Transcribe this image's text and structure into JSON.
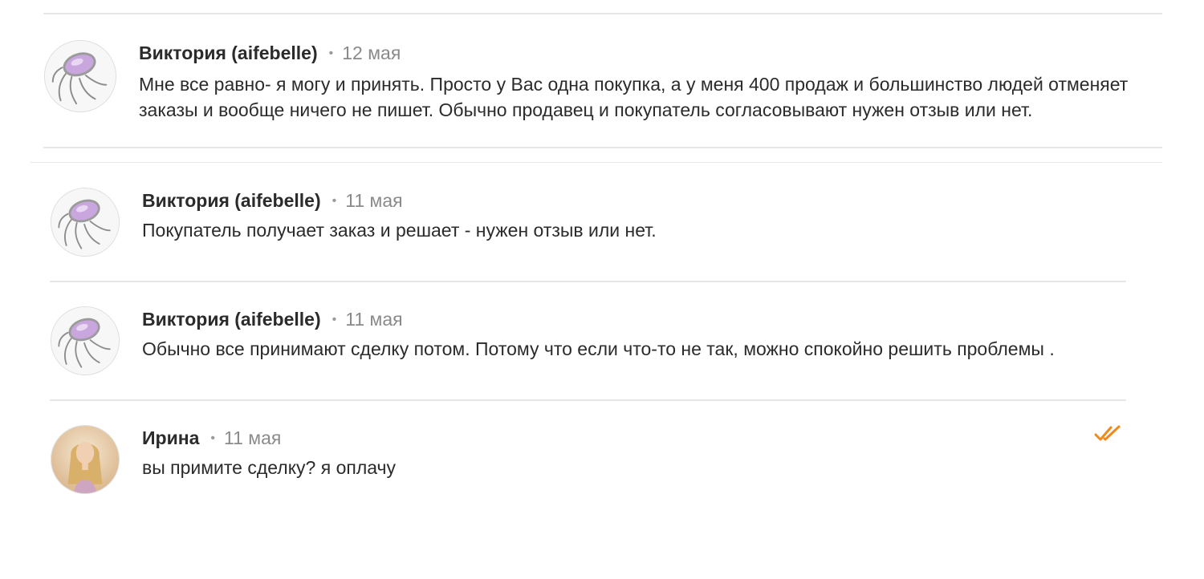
{
  "messages": [
    {
      "author": "Виктория (aifebelle)",
      "separator": "•",
      "date": "12 мая",
      "text": "Мне все равно- я могу и принять. Просто у Вас одна покупка, а у меня 400 продаж и большинство людей отменяет заказы и вообще ничего не пишет. Обычно продавец и покупатель согласовывают нужен отзыв или нет.",
      "avatar_icon": "ring-amethyst-avatar"
    },
    {
      "author": "Виктория (aifebelle)",
      "separator": "•",
      "date": "11 мая",
      "text": "Покупатель получает заказ и решает - нужен отзыв или нет.",
      "avatar_icon": "ring-amethyst-avatar"
    },
    {
      "author": "Виктория (aifebelle)",
      "separator": "•",
      "date": "11 мая",
      "text": "Обычно все принимают сделку потом. Потому что если что-то не так, можно спокойно решить проблемы .",
      "avatar_icon": "ring-amethyst-avatar"
    },
    {
      "author": "Ирина",
      "separator": "•",
      "date": "11 мая",
      "text": "вы примите сделку? я оплачу",
      "avatar_icon": "user-photo-avatar",
      "status_icon": "double-check-read-icon"
    }
  ],
  "colors": {
    "text": "#2b2b2b",
    "date": "#8a8a8a",
    "divider": "#e6e6e6",
    "read_check": "#f08a1c"
  }
}
